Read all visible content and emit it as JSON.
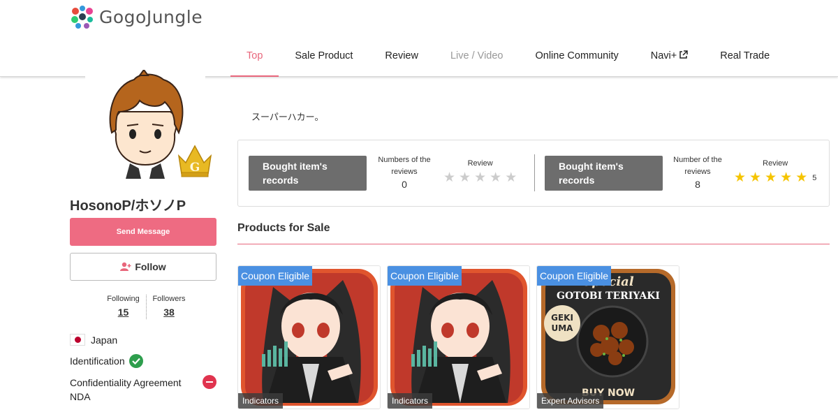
{
  "brand": {
    "name": "GogoJungle"
  },
  "nav": {
    "items": [
      {
        "label": "Top",
        "state": "active"
      },
      {
        "label": "Sale Product",
        "state": "normal"
      },
      {
        "label": "Review",
        "state": "normal"
      },
      {
        "label": "Live / Video",
        "state": "disabled"
      },
      {
        "label": "Online Community",
        "state": "normal"
      },
      {
        "label": "Navi+",
        "state": "external"
      },
      {
        "label": "Real Trade",
        "state": "normal"
      }
    ]
  },
  "profile": {
    "badge_letter": "G",
    "username": "HosonoP/ホソノP",
    "send_message_label": "Send Message",
    "follow_label": "Follow",
    "following_label": "Following",
    "following_count": "15",
    "followers_label": "Followers",
    "followers_count": "38",
    "country": "Japan",
    "identification_label": "Identification",
    "identification_verified": true,
    "nda_label": "Confidentiality Agreement NDA",
    "nda_signed": false
  },
  "bio": "スーパーハカー。",
  "records": {
    "left": {
      "button_label": "Bought item's records",
      "count_label": "Numbers of the reviews",
      "count": "0",
      "review_label": "Review",
      "rating": 0
    },
    "right": {
      "button_label": "Bought item's records",
      "count_label": "Number of the reviews",
      "count": "8",
      "review_label": "Review",
      "rating": 5,
      "rating_text": "5"
    }
  },
  "products_section": {
    "title": "Products for Sale",
    "items": [
      {
        "coupon": "Coupon Eligible",
        "category": "Indicators",
        "image": "anime-trader-girl"
      },
      {
        "coupon": "Coupon Eligible",
        "category": "Indicators",
        "image": "anime-trader-girl"
      },
      {
        "coupon": "Coupon Eligible",
        "category": "Expert Advisors",
        "image": "gotobi-teriyaki",
        "image_text_1": "GOTOBI TERIYAKI",
        "image_text_2": "GEKI UMA",
        "image_text_3": "BUY NOW",
        "image_text_4": "Special"
      }
    ]
  },
  "colors": {
    "accent": "#e8667b",
    "button": "#ee6b82",
    "coupon": "#4a90e2",
    "star": "#f5c400"
  }
}
